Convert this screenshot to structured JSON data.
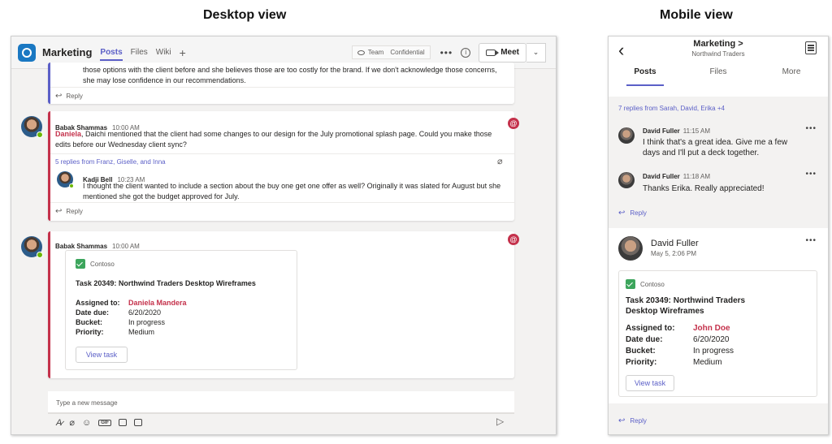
{
  "titles": {
    "desktop": "Desktop view",
    "mobile": "Mobile view"
  },
  "desktop": {
    "header": {
      "channel": "Marketing",
      "tabs": [
        "Posts",
        "Files",
        "Wiki"
      ],
      "add_tab": "+",
      "tag_team": "Team",
      "tag_confidential": "Confidential",
      "more": "•••",
      "info": "i",
      "meet_label": "Meet",
      "meet_chevron": "⌄"
    },
    "post0": {
      "text_line1": "those options with the client before and she believes those are too costly for the brand. If we don't acknowledge those concerns,",
      "text_line2": "she may lose confidence in our recommendations.",
      "reply": "Reply"
    },
    "post1": {
      "author": "Babak Shammas",
      "time": "10:00 AM",
      "mention": "Daniela",
      "text_rest": ", Daichi mentioned that the client had some changes to our design for the July promotional splash page. Could you make those edits before our Wednesday client sync?",
      "replies_link": "5 replies from Franz, Giselle, and Inna",
      "reply_author": "Kadji Bell",
      "reply_time": "10:23 AM",
      "reply_text": "I thought the client wanted to include a section about the buy one get one offer as well? Originally it was slated for August but she mentioned she got the budget approved for July.",
      "reply": "Reply",
      "badge": "@"
    },
    "post2": {
      "author": "Babak Shammas",
      "time": "10:00 AM",
      "badge": "@",
      "task": {
        "app": "Contoso",
        "title": "Task 20349: Northwind Traders Desktop Wireframes",
        "rows": [
          {
            "k": "Assigned to:",
            "v": "Daniela Mandera"
          },
          {
            "k": "Date due:",
            "v": "6/20/2020"
          },
          {
            "k": "Bucket:",
            "v": "In progress"
          },
          {
            "k": "Priority:",
            "v": "Medium"
          }
        ],
        "button": "View task"
      }
    },
    "compose": {
      "placeholder": "Type a new message"
    }
  },
  "mobile": {
    "header": {
      "title": "Marketing >",
      "subtitle": "Northwind Traders",
      "tabs": [
        "Posts",
        "Files",
        "More"
      ]
    },
    "thread": {
      "replies_link": "7 replies from Sarah, David, Erika +4",
      "messages": [
        {
          "author": "David Fuller",
          "time": "11:15 AM",
          "text": "I think that's a great idea. Give me a few days and I'll put a deck together."
        },
        {
          "author": "David Fuller",
          "time": "11:18 AM",
          "text": "Thanks Erika. Really appreciated!"
        }
      ],
      "reply": "Reply"
    },
    "post": {
      "author": "David Fuller",
      "date": "May 5, 2:06 PM",
      "task": {
        "app": "Contoso",
        "title": "Task 20349: Northwind Traders Desktop Wireframes",
        "rows": [
          {
            "k": "Assigned to:",
            "v": "John Doe"
          },
          {
            "k": "Date due:",
            "v": "6/20/2020"
          },
          {
            "k": "Bucket:",
            "v": "In progress"
          },
          {
            "k": "Priority:",
            "v": "Medium"
          }
        ],
        "button": "View task"
      },
      "reply": "Reply"
    }
  }
}
